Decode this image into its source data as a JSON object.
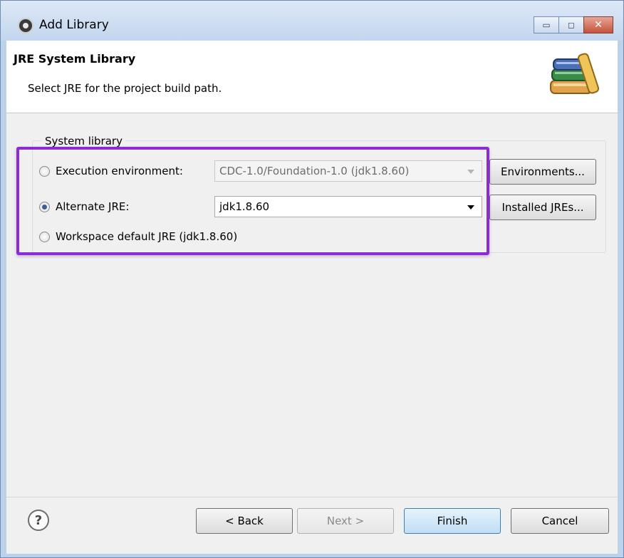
{
  "window": {
    "title": "Add Library",
    "minimize_glyph": "▭",
    "maximize_glyph": "◻",
    "close_glyph": "✕"
  },
  "header": {
    "title": "JRE System Library",
    "description": "Select JRE for the project build path.",
    "icon": "books-icon"
  },
  "system_library": {
    "group_label": "System library",
    "execution_environment": {
      "label": "Execution environment:",
      "selected": false,
      "value": "CDC-1.0/Foundation-1.0 (jdk1.8.60)",
      "enabled": false,
      "button_label": "Environments..."
    },
    "alternate_jre": {
      "label": "Alternate JRE:",
      "selected": true,
      "value": "jdk1.8.60",
      "button_label": "Installed JREs..."
    },
    "workspace_default": {
      "label": "Workspace default JRE (jdk1.8.60)",
      "selected": false
    }
  },
  "footer": {
    "help_glyph": "?",
    "back_label": "< Back",
    "next_label": "Next >",
    "finish_label": "Finish",
    "cancel_label": "Cancel"
  },
  "colors": {
    "highlight_border": "#8a2bd6",
    "radio_dot": "#3d5e9e",
    "default_button": "#c0def5"
  }
}
